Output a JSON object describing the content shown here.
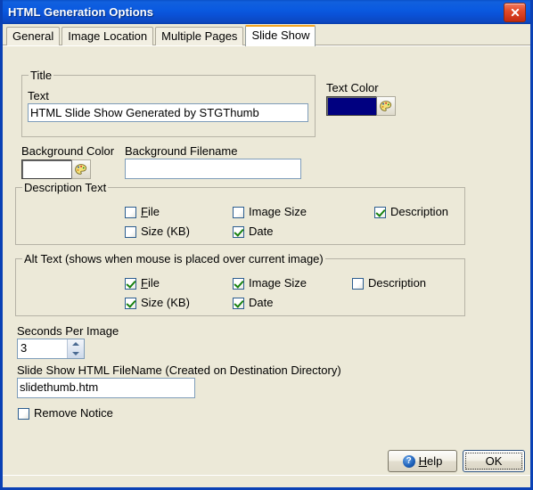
{
  "window": {
    "title": "HTML Generation Options",
    "close_icon": "close-icon",
    "border_color": "#0a41b5",
    "body_color": "#ece9d8"
  },
  "tabs": [
    {
      "label": "General",
      "active": false
    },
    {
      "label": "Image Location",
      "active": false
    },
    {
      "label": "Multiple Pages",
      "active": false
    },
    {
      "label": "Slide Show",
      "active": true
    }
  ],
  "title_group": {
    "legend": "Title",
    "text_label": "Text",
    "text_value": "HTML Slide Show Generated by STGThumb",
    "text_placeholder": ""
  },
  "text_color": {
    "label": "Text Color",
    "value": "#000080",
    "picker_icon": "palette-icon"
  },
  "background_color": {
    "label": "Background Color",
    "value": "#ffffff",
    "picker_icon": "palette-icon"
  },
  "background_filename": {
    "label": "Background Filename",
    "value": "",
    "placeholder": ""
  },
  "description_text": {
    "legend": "Description Text",
    "options": [
      {
        "label": "File",
        "accel": "F",
        "checked": false
      },
      {
        "label": "Image Size",
        "accel": "",
        "checked": false
      },
      {
        "label": "Description",
        "accel": "",
        "checked": true
      },
      {
        "label": "Size (KB)",
        "accel": "",
        "checked": false
      },
      {
        "label": "Date",
        "accel": "",
        "checked": true
      }
    ]
  },
  "alt_text": {
    "legend": "Alt Text (shows when mouse is placed over current image)",
    "options": [
      {
        "label": "File",
        "accel": "F",
        "checked": true
      },
      {
        "label": "Image Size",
        "accel": "",
        "checked": true
      },
      {
        "label": "Description",
        "accel": "",
        "checked": false
      },
      {
        "label": "Size (KB)",
        "accel": "",
        "checked": true
      },
      {
        "label": "Date",
        "accel": "",
        "checked": true
      }
    ]
  },
  "seconds_per_image": {
    "label": "Seconds Per Image",
    "value": "3"
  },
  "slideshow_filename": {
    "label": "Slide Show HTML FileName (Created on Destination Directory)",
    "value": "slidethumb.htm",
    "placeholder": ""
  },
  "remove_notice": {
    "label": "Remove Notice",
    "checked": false
  },
  "buttons": {
    "help": {
      "label": "Help",
      "accel": "H",
      "icon": "help-icon"
    },
    "ok": {
      "label": "OK",
      "focused": true
    }
  }
}
